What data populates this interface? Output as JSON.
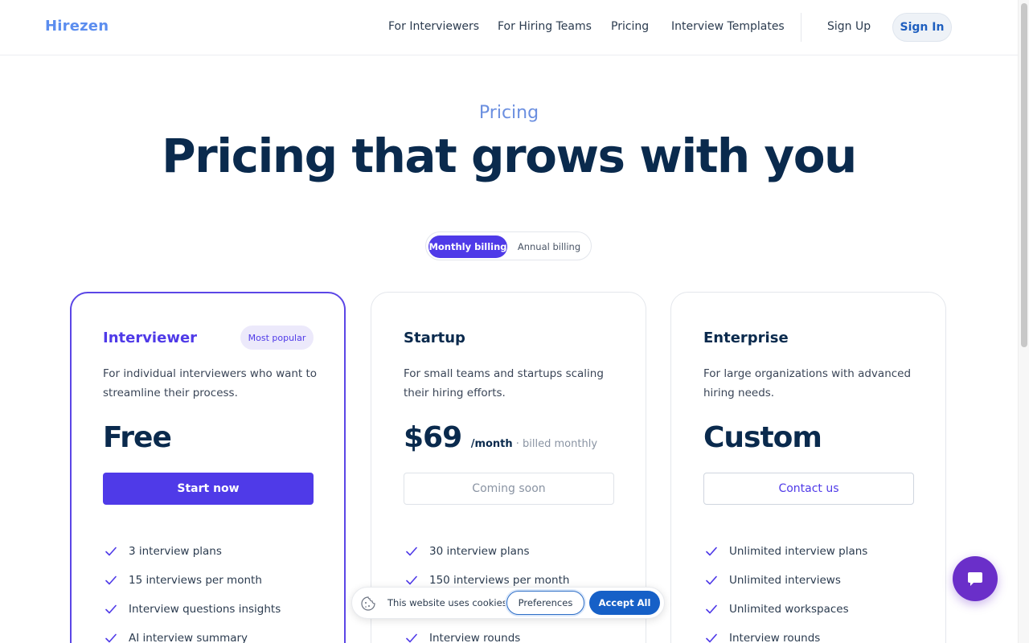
{
  "header": {
    "logo": "Hirezen",
    "nav": [
      "For Interviewers",
      "For Hiring Teams",
      "Pricing",
      "Interview Templates"
    ],
    "sign_up": "Sign Up",
    "sign_in": "Sign In"
  },
  "hero": {
    "eyebrow": "Pricing",
    "title": "Pricing that grows with you"
  },
  "billing": {
    "monthly": "Monthly billing",
    "annual": "Annual billing",
    "selected": "Monthly billing"
  },
  "plans": [
    {
      "name": "Interviewer",
      "badge": "Most popular",
      "description": "For individual interviewers who want to streamline their process.",
      "price": "Free",
      "cta": "Start now",
      "features": [
        "3 interview plans",
        "15 interviews per month",
        "Interview questions insights",
        "AI interview summary"
      ]
    },
    {
      "name": "Startup",
      "description": "For small teams and startups scaling their hiring efforts.",
      "price": "$69",
      "price_unit": "/month",
      "price_note": " · billed monthly",
      "cta": "Coming soon",
      "features": [
        "30 interview plans",
        "150 interviews per month",
        "",
        "Interview rounds"
      ]
    },
    {
      "name": "Enterprise",
      "description": "For large organizations with advanced hiring needs.",
      "price": "Custom",
      "cta": "Contact us",
      "features": [
        "Unlimited interview plans",
        "Unlimited interviews",
        "Unlimited workspaces",
        "Interview rounds"
      ]
    }
  ],
  "cookie": {
    "icon": "cookie-icon",
    "text": "This website uses cookies",
    "preferences": "Preferences",
    "accept": "Accept All"
  },
  "chat": {
    "icon": "chat-icon"
  },
  "colors": {
    "accent": "#4f3ae8",
    "brand": "#5b8def",
    "heading": "#0a2a4d",
    "chat": "#6a2fc9",
    "cookie_accept": "#1660c7"
  }
}
